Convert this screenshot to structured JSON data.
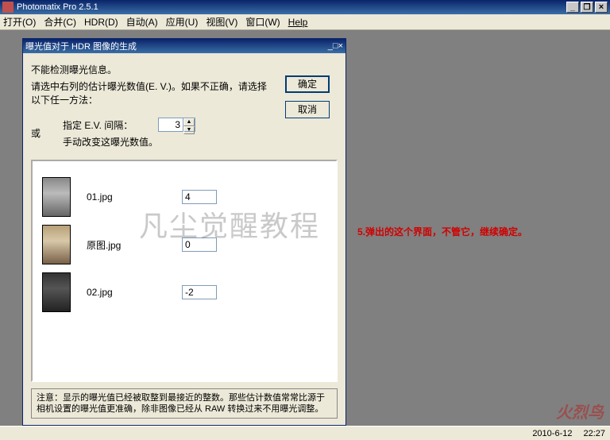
{
  "app": {
    "title": "Photomatix Pro 2.5.1"
  },
  "menu": {
    "open": "打开(O)",
    "merge": "合并(C)",
    "hdr": "HDR(D)",
    "automate": "自动(A)",
    "apply": "应用(U)",
    "view": "视图(V)",
    "window": "窗口(W)",
    "help": "Help"
  },
  "dialog": {
    "title": "曝光值对于 HDR 图像的生成",
    "line1": "不能检测曝光信息。",
    "line2": "请选中右列的估计曝光数值(E. V.)。如果不正确，请选择以下任一方法：",
    "or": "或",
    "ev_label": "指定 E.V. 间隔：",
    "ev_value": "3",
    "manual_label": "手动改变这曝光数值。",
    "ok": "确定",
    "cancel": "取消",
    "files": [
      {
        "name": "01.jpg",
        "ev": "4"
      },
      {
        "name": "原图.jpg",
        "ev": "0"
      },
      {
        "name": "02.jpg",
        "ev": "-2"
      }
    ],
    "note": "注意：显示的曝光值已经被取整到最接近的整数。那些估计数值常常比源于相机设置的曝光值更准确，除非图像已经从 RAW 转换过来不用曝光调整。"
  },
  "watermark": "凡尘觉醒教程",
  "annotation": "5.弹出的这个界面，不管它，继续确定。",
  "logo": "火烈鸟",
  "status": {
    "date": "2010-6-12",
    "time": "22:27"
  }
}
